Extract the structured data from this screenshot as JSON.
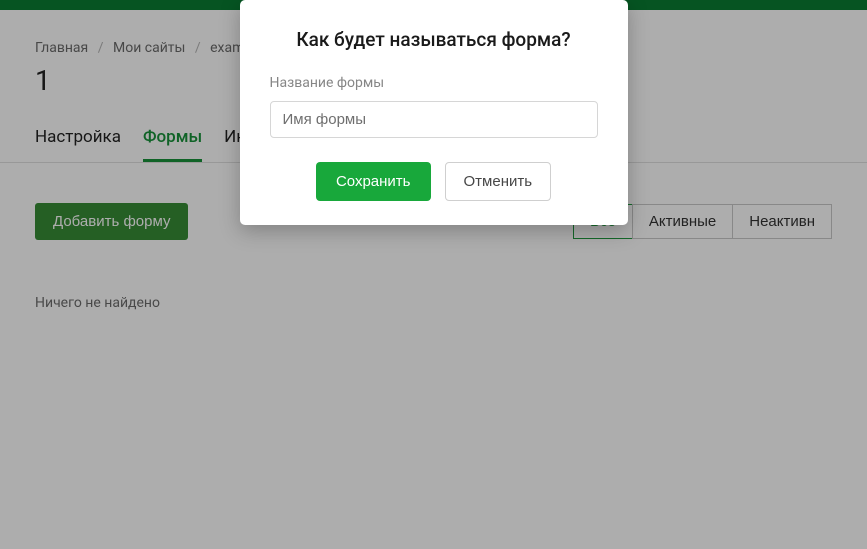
{
  "breadcrumb": {
    "items": [
      "Главная",
      "Мои сайты",
      "example.co"
    ]
  },
  "page_title": "1",
  "tabs": {
    "settings": "Настройка",
    "forms": "Формы",
    "integrations": "Инт"
  },
  "toolbar": {
    "add_form_label": "Добавить форму"
  },
  "filters": {
    "all": "Все",
    "active": "Активные",
    "inactive": "Неактивн"
  },
  "empty_message": "Ничего не найдено",
  "modal": {
    "title": "Как будет называться форма?",
    "field_label": "Название формы",
    "input_placeholder": "Имя формы",
    "input_value": "",
    "save_label": "Сохранить",
    "cancel_label": "Отменить"
  }
}
